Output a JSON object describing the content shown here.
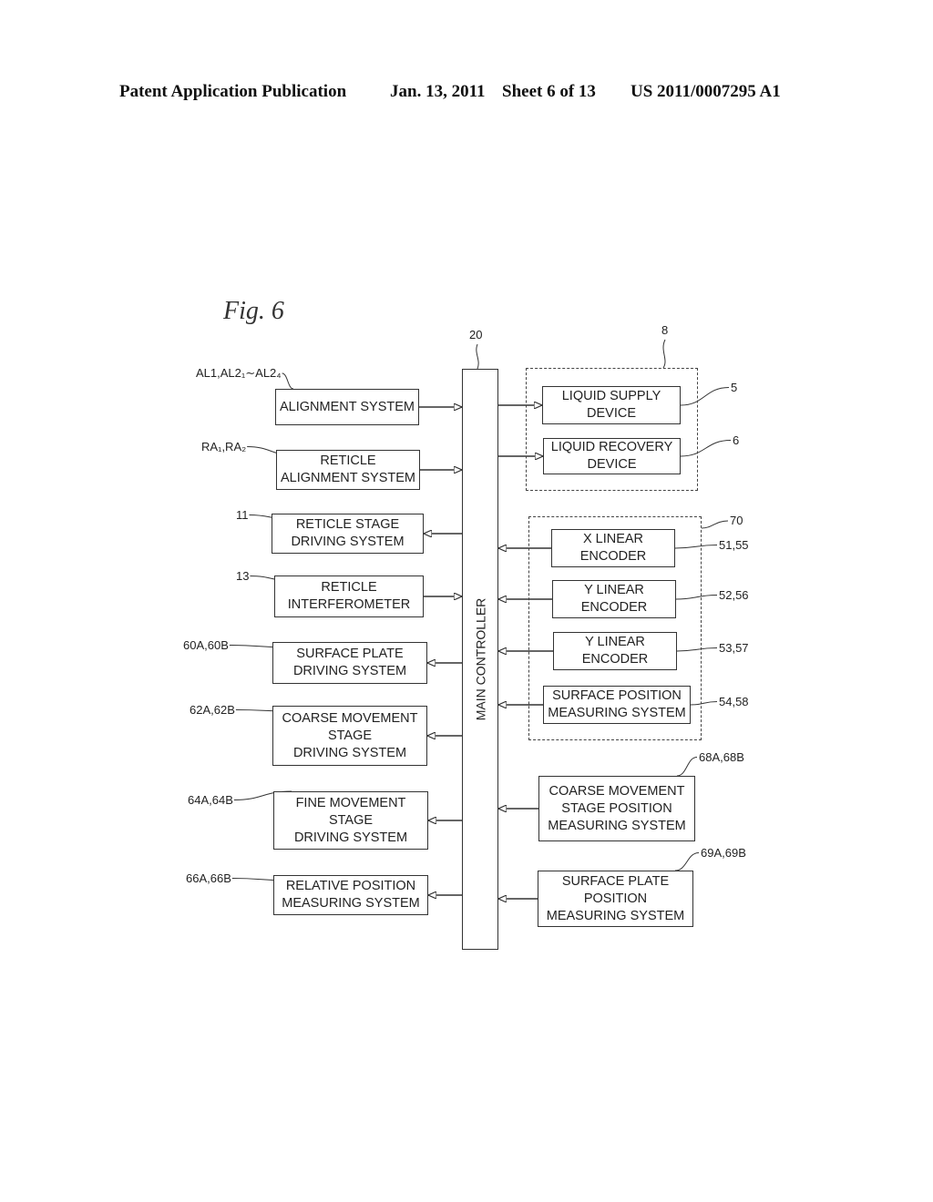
{
  "header": {
    "publication": "Patent Application Publication",
    "date": "Jan. 13, 2011",
    "sheet": "Sheet 6 of 13",
    "number": "US 2011/0007295 A1"
  },
  "figure": {
    "title": "Fig. 6",
    "main_controller": {
      "label": "MAIN CONTROLLER",
      "ref": "20"
    },
    "left_blocks": [
      {
        "label": "ALIGNMENT SYSTEM",
        "ref": "AL1,AL2₁∼AL2₄",
        "direction": "to-controller"
      },
      {
        "label": "RETICLE\nALIGNMENT SYSTEM",
        "ref": "RA₁,RA₂",
        "direction": "to-controller"
      },
      {
        "label": "RETICLE STAGE\nDRIVING SYSTEM",
        "ref": "11",
        "direction": "from-controller"
      },
      {
        "label": "RETICLE\nINTERFEROMETER",
        "ref": "13",
        "direction": "to-controller"
      },
      {
        "label": "SURFACE PLATE\nDRIVING SYSTEM",
        "ref": "60A,60B",
        "direction": "from-controller"
      },
      {
        "label": "COARSE MOVEMENT\nSTAGE\nDRIVING SYSTEM",
        "ref": "62A,62B",
        "direction": "from-controller"
      },
      {
        "label": "FINE MOVEMENT\nSTAGE\nDRIVING SYSTEM",
        "ref": "64A,64B",
        "direction": "from-controller"
      },
      {
        "label": "RELATIVE POSITION\nMEASURING SYSTEM",
        "ref": "66A,66B",
        "direction": "from-controller"
      }
    ],
    "group_8": {
      "ref": "8",
      "blocks": [
        {
          "label": "LIQUID SUPPLY\nDEVICE",
          "ref": "5",
          "direction": "from-controller"
        },
        {
          "label": "LIQUID RECOVERY\nDEVICE",
          "ref": "6",
          "direction": "from-controller"
        }
      ]
    },
    "group_70": {
      "ref": "70",
      "blocks": [
        {
          "label": "X LINEAR\nENCODER",
          "ref": "51,55",
          "direction": "to-controller"
        },
        {
          "label": "Y LINEAR\nENCODER",
          "ref": "52,56",
          "direction": "to-controller"
        },
        {
          "label": "Y LINEAR\nENCODER",
          "ref": "53,57",
          "direction": "to-controller"
        },
        {
          "label": "SURFACE POSITION\nMEASURING SYSTEM",
          "ref": "54,58",
          "direction": "to-controller"
        }
      ]
    },
    "right_blocks": [
      {
        "label": "COARSE MOVEMENT\nSTAGE POSITION\nMEASURING SYSTEM",
        "ref": "68A,68B",
        "direction": "to-controller"
      },
      {
        "label": "SURFACE PLATE\nPOSITION\nMEASURING SYSTEM",
        "ref": "69A,69B",
        "direction": "to-controller"
      }
    ]
  }
}
